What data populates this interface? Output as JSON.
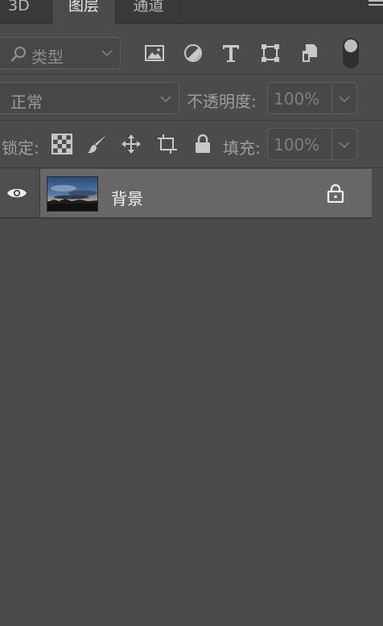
{
  "tabs": [
    {
      "label": "3D"
    },
    {
      "label": "图层",
      "active": true
    },
    {
      "label": "通道"
    }
  ],
  "filter": {
    "kind_label": "类型",
    "icons": [
      "image-filter-icon",
      "adjustment-filter-icon",
      "type-filter-icon",
      "shape-filter-icon",
      "smart-object-filter-icon"
    ]
  },
  "blend": {
    "mode": "正常",
    "opacity_label": "不透明度:",
    "opacity_value": "100%"
  },
  "lock": {
    "label": "锁定:",
    "icons": [
      "lock-transparent-pixels-icon",
      "lock-image-pixels-icon",
      "lock-position-icon",
      "lock-artboard-icon",
      "lock-all-icon"
    ],
    "fill_label": "填充:",
    "fill_value": "100%"
  },
  "layers": [
    {
      "name": "背景",
      "visible": true,
      "locked": true
    }
  ],
  "colors": {
    "panel_bg": "#4b4b4b",
    "selected_row": "#676767",
    "tab_bar": "#3a3a3a"
  }
}
